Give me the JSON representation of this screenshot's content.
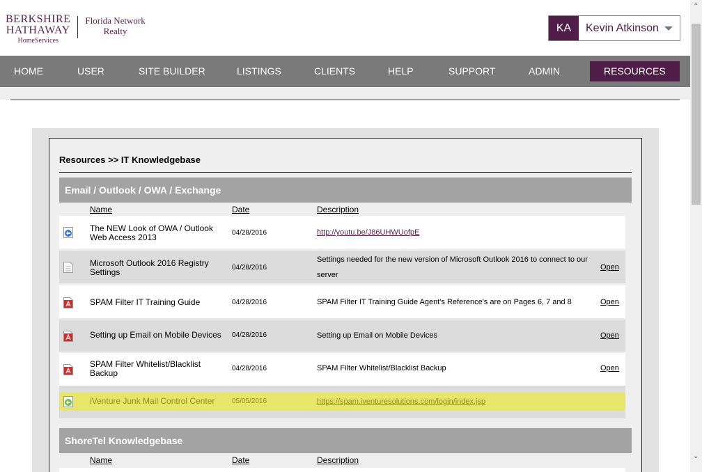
{
  "brand": {
    "line1": "BERKSHIRE",
    "line2": "HATHAWAY",
    "line3": "HomeServices",
    "sub1": "Florida Network",
    "sub2": "Realty"
  },
  "user": {
    "initials": "KA",
    "name": "Kevin Atkinson"
  },
  "nav": [
    "HOME",
    "USER",
    "SITE BUILDER",
    "LISTINGS",
    "CLIENTS",
    "HELP",
    "SUPPORT",
    "ADMIN",
    "RESOURCES"
  ],
  "breadcrumb": "Resources >> IT Knowledgebase",
  "columns": {
    "name": "Name",
    "date": "Date",
    "description": "Description"
  },
  "sections": [
    {
      "title": "Email / Outlook / OWA / Exchange",
      "rows": [
        {
          "icon": "web-link-icon",
          "name": "The NEW Look of OWA / Outlook Web Access 2013",
          "date": "04/28/2016",
          "description": "http://youtu.be/J86UHWUofpE",
          "is_link": true,
          "open": ""
        },
        {
          "icon": "document-icon",
          "name": "Microsoft Outlook 2016 Registry Settings",
          "date": "04/28/2016",
          "description": "Settings needed for the new version of Microsoft Outlook 2016 to connect to our server",
          "is_link": false,
          "open": "Open"
        },
        {
          "icon": "pdf-icon",
          "name": "SPAM Filter IT Training Guide",
          "date": "04/28/2016",
          "description": "SPAM Filter IT Training Guide Agent's Reference's are on Pages 6, 7 and 8",
          "is_link": false,
          "open": "Open"
        },
        {
          "icon": "pdf-icon",
          "name": "Setting up Email on Mobile Devices",
          "date": "04/28/2016",
          "description": "Setting up Email on Mobile Devices",
          "is_link": false,
          "open": "Open"
        },
        {
          "icon": "pdf-icon",
          "name": "SPAM Filter Whitelist/Blacklist Backup",
          "date": "04/28/2016",
          "description": "SPAM Filter Whitelist/Blacklist Backup",
          "is_link": false,
          "open": "Open"
        },
        {
          "icon": "web-link-icon",
          "name": "iVenture Junk Mail Control Center",
          "date": "05/05/2016",
          "description": "https://spam.iventuresolutions.com/login/index.jsp",
          "is_link": true,
          "open": ""
        }
      ]
    },
    {
      "title": "ShoreTel Knowledgebase",
      "rows": []
    }
  ],
  "colors": {
    "brand": "#4f1d47",
    "nav": "#7a7a7a",
    "section": "#a3a3a3",
    "highlight": "#e6e66a"
  }
}
